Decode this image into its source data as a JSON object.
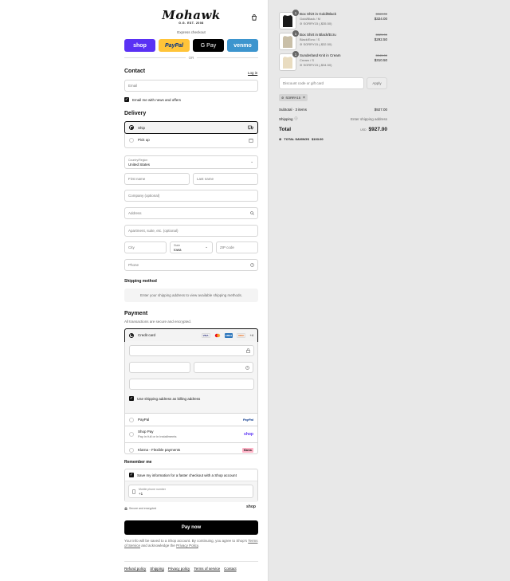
{
  "logo": {
    "wordmark": "Mohawk",
    "est": "G.G. EST. 2008"
  },
  "express": {
    "label": "Express checkout",
    "shop": "shop",
    "paypal": "PayPal",
    "gpay": "G Pay",
    "venmo": "venmo",
    "or": "OR"
  },
  "contact": {
    "heading": "Contact",
    "login": "Log in",
    "email_placeholder": "Email",
    "news_label": "Email me with news and offers"
  },
  "delivery": {
    "heading": "Delivery",
    "ship": "Ship",
    "pickup": "Pick up",
    "country_label": "Country/Region",
    "country_value": "United States",
    "first_name": "First name",
    "last_name": "Last name",
    "company": "Company (optional)",
    "address": "Address",
    "apartment": "Apartment, suite, etc. (optional)",
    "city": "City",
    "state_label": "State",
    "state_value": "Iowa",
    "zip": "ZIP code",
    "phone": "Phone"
  },
  "shipping": {
    "heading": "Shipping method",
    "notice": "Enter your shipping address to view available shipping methods."
  },
  "payment": {
    "heading": "Payment",
    "subtitle": "All transactions are secure and encrypted.",
    "credit_card": "Credit card",
    "more_cards": "+4",
    "cards": [
      "VISA",
      "MC",
      "AMEX",
      "DISC"
    ],
    "billing_same": "Use shipping address as billing address",
    "paypal": "PayPal",
    "paypal_logo": "PayPal",
    "shoppay": "Shop Pay",
    "shoppay_sub": "Pay in full or in installments",
    "shoppay_logo": "shop",
    "klarna": "Klarna - Flexible payments",
    "klarna_logo": "Klarna."
  },
  "remember": {
    "heading": "Remember me",
    "save_label": "Save my information for a faster checkout with a Shop account",
    "mobile_label": "Mobile phone number",
    "mobile_prefix": "+1",
    "secure": "Secure and encrypted",
    "shop_logo": "shop"
  },
  "paynow": "Pay now",
  "legal": {
    "text": "Your info will be saved to a Shop account. By continuing, you agree to Shop's",
    "terms": "Terms of Service",
    "and": "and acknowledge the",
    "privacy": "Privacy Policy",
    "end": "."
  },
  "footer": {
    "links": [
      "Refund policy",
      "Shipping",
      "Privacy policy",
      "Terms of service",
      "Contact"
    ]
  },
  "order": {
    "items": [
      {
        "qty": "1",
        "name": "Box Shirt in Gold/Black",
        "variant": "Gold/Black / M",
        "discount": "SORRY15 (-$35.50)",
        "old": "$360.00",
        "price": "$324.00",
        "color": "#1a1a1a"
      },
      {
        "qty": "1",
        "name": "Box Shirt in Black/Ecru",
        "variant": "Black/Ecru / S",
        "discount": "SORRY15 (-$32.50)",
        "old": "$325.00",
        "price": "$292.50",
        "color": "#c9bfa8"
      },
      {
        "qty": "1",
        "name": "Sunderland Knit in Cream",
        "variant": "Cream / S",
        "discount": "SORRY15 (-$34.50)",
        "old": "$345.00",
        "price": "$310.50",
        "color": "#e9dcc0"
      }
    ],
    "discount_placeholder": "Discount code or gift card",
    "apply": "Apply",
    "code": "SORRY15",
    "subtotal_label": "Subtotal · 3 items",
    "subtotal": "$927.00",
    "shipping_label": "Shipping",
    "shipping_value": "Enter shipping address",
    "total_label": "Total",
    "currency": "USD",
    "total": "$927.00",
    "savings_label": "TOTAL SAVINGS",
    "savings": "$103.00"
  }
}
